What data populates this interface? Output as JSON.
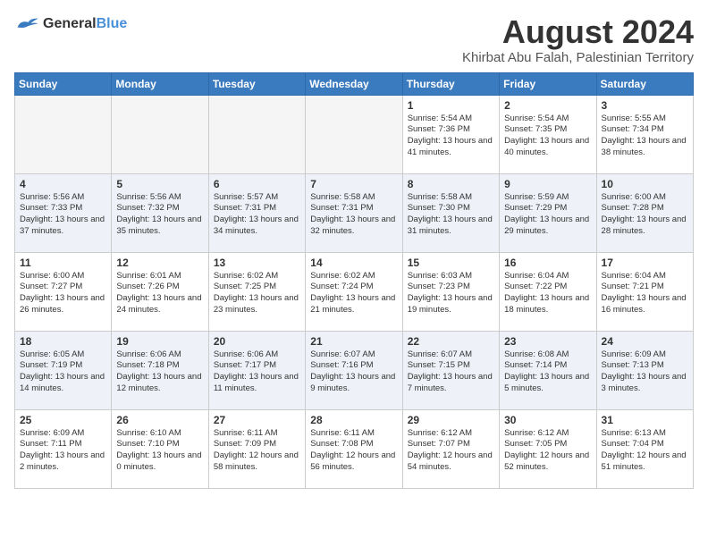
{
  "header": {
    "logo_general": "General",
    "logo_blue": "Blue",
    "main_title": "August 2024",
    "subtitle": "Khirbat Abu Falah, Palestinian Territory"
  },
  "days_of_week": [
    "Sunday",
    "Monday",
    "Tuesday",
    "Wednesday",
    "Thursday",
    "Friday",
    "Saturday"
  ],
  "weeks": [
    {
      "row_class": "row-odd",
      "days": [
        {
          "num": "",
          "info": "",
          "empty": true
        },
        {
          "num": "",
          "info": "",
          "empty": true
        },
        {
          "num": "",
          "info": "",
          "empty": true
        },
        {
          "num": "",
          "info": "",
          "empty": true
        },
        {
          "num": "1",
          "info": "Sunrise: 5:54 AM\nSunset: 7:36 PM\nDaylight: 13 hours\nand 41 minutes.",
          "empty": false
        },
        {
          "num": "2",
          "info": "Sunrise: 5:54 AM\nSunset: 7:35 PM\nDaylight: 13 hours\nand 40 minutes.",
          "empty": false
        },
        {
          "num": "3",
          "info": "Sunrise: 5:55 AM\nSunset: 7:34 PM\nDaylight: 13 hours\nand 38 minutes.",
          "empty": false
        }
      ]
    },
    {
      "row_class": "row-even",
      "days": [
        {
          "num": "4",
          "info": "Sunrise: 5:56 AM\nSunset: 7:33 PM\nDaylight: 13 hours\nand 37 minutes.",
          "empty": false
        },
        {
          "num": "5",
          "info": "Sunrise: 5:56 AM\nSunset: 7:32 PM\nDaylight: 13 hours\nand 35 minutes.",
          "empty": false
        },
        {
          "num": "6",
          "info": "Sunrise: 5:57 AM\nSunset: 7:31 PM\nDaylight: 13 hours\nand 34 minutes.",
          "empty": false
        },
        {
          "num": "7",
          "info": "Sunrise: 5:58 AM\nSunset: 7:31 PM\nDaylight: 13 hours\nand 32 minutes.",
          "empty": false
        },
        {
          "num": "8",
          "info": "Sunrise: 5:58 AM\nSunset: 7:30 PM\nDaylight: 13 hours\nand 31 minutes.",
          "empty": false
        },
        {
          "num": "9",
          "info": "Sunrise: 5:59 AM\nSunset: 7:29 PM\nDaylight: 13 hours\nand 29 minutes.",
          "empty": false
        },
        {
          "num": "10",
          "info": "Sunrise: 6:00 AM\nSunset: 7:28 PM\nDaylight: 13 hours\nand 28 minutes.",
          "empty": false
        }
      ]
    },
    {
      "row_class": "row-odd",
      "days": [
        {
          "num": "11",
          "info": "Sunrise: 6:00 AM\nSunset: 7:27 PM\nDaylight: 13 hours\nand 26 minutes.",
          "empty": false
        },
        {
          "num": "12",
          "info": "Sunrise: 6:01 AM\nSunset: 7:26 PM\nDaylight: 13 hours\nand 24 minutes.",
          "empty": false
        },
        {
          "num": "13",
          "info": "Sunrise: 6:02 AM\nSunset: 7:25 PM\nDaylight: 13 hours\nand 23 minutes.",
          "empty": false
        },
        {
          "num": "14",
          "info": "Sunrise: 6:02 AM\nSunset: 7:24 PM\nDaylight: 13 hours\nand 21 minutes.",
          "empty": false
        },
        {
          "num": "15",
          "info": "Sunrise: 6:03 AM\nSunset: 7:23 PM\nDaylight: 13 hours\nand 19 minutes.",
          "empty": false
        },
        {
          "num": "16",
          "info": "Sunrise: 6:04 AM\nSunset: 7:22 PM\nDaylight: 13 hours\nand 18 minutes.",
          "empty": false
        },
        {
          "num": "17",
          "info": "Sunrise: 6:04 AM\nSunset: 7:21 PM\nDaylight: 13 hours\nand 16 minutes.",
          "empty": false
        }
      ]
    },
    {
      "row_class": "row-even",
      "days": [
        {
          "num": "18",
          "info": "Sunrise: 6:05 AM\nSunset: 7:19 PM\nDaylight: 13 hours\nand 14 minutes.",
          "empty": false
        },
        {
          "num": "19",
          "info": "Sunrise: 6:06 AM\nSunset: 7:18 PM\nDaylight: 13 hours\nand 12 minutes.",
          "empty": false
        },
        {
          "num": "20",
          "info": "Sunrise: 6:06 AM\nSunset: 7:17 PM\nDaylight: 13 hours\nand 11 minutes.",
          "empty": false
        },
        {
          "num": "21",
          "info": "Sunrise: 6:07 AM\nSunset: 7:16 PM\nDaylight: 13 hours\nand 9 minutes.",
          "empty": false
        },
        {
          "num": "22",
          "info": "Sunrise: 6:07 AM\nSunset: 7:15 PM\nDaylight: 13 hours\nand 7 minutes.",
          "empty": false
        },
        {
          "num": "23",
          "info": "Sunrise: 6:08 AM\nSunset: 7:14 PM\nDaylight: 13 hours\nand 5 minutes.",
          "empty": false
        },
        {
          "num": "24",
          "info": "Sunrise: 6:09 AM\nSunset: 7:13 PM\nDaylight: 13 hours\nand 3 minutes.",
          "empty": false
        }
      ]
    },
    {
      "row_class": "row-odd",
      "days": [
        {
          "num": "25",
          "info": "Sunrise: 6:09 AM\nSunset: 7:11 PM\nDaylight: 13 hours\nand 2 minutes.",
          "empty": false
        },
        {
          "num": "26",
          "info": "Sunrise: 6:10 AM\nSunset: 7:10 PM\nDaylight: 13 hours\nand 0 minutes.",
          "empty": false
        },
        {
          "num": "27",
          "info": "Sunrise: 6:11 AM\nSunset: 7:09 PM\nDaylight: 12 hours\nand 58 minutes.",
          "empty": false
        },
        {
          "num": "28",
          "info": "Sunrise: 6:11 AM\nSunset: 7:08 PM\nDaylight: 12 hours\nand 56 minutes.",
          "empty": false
        },
        {
          "num": "29",
          "info": "Sunrise: 6:12 AM\nSunset: 7:07 PM\nDaylight: 12 hours\nand 54 minutes.",
          "empty": false
        },
        {
          "num": "30",
          "info": "Sunrise: 6:12 AM\nSunset: 7:05 PM\nDaylight: 12 hours\nand 52 minutes.",
          "empty": false
        },
        {
          "num": "31",
          "info": "Sunrise: 6:13 AM\nSunset: 7:04 PM\nDaylight: 12 hours\nand 51 minutes.",
          "empty": false
        }
      ]
    }
  ]
}
